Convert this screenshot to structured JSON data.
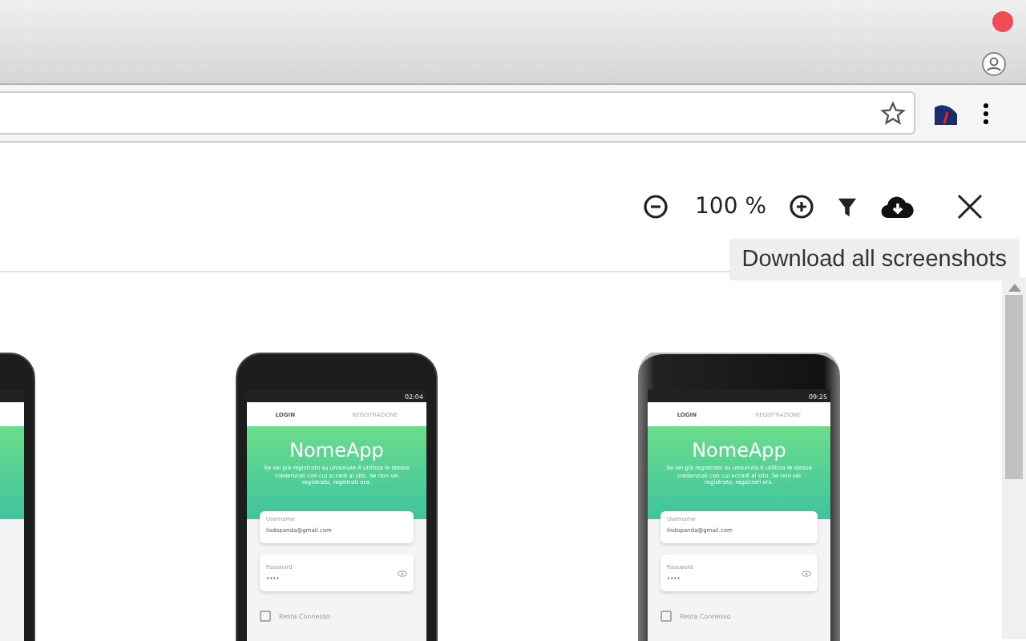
{
  "toolbar": {
    "zoom": "100 %",
    "tooltip": "Download all screenshots"
  },
  "screenshots": [
    {
      "kind": "cropped"
    },
    {
      "kind": "dark",
      "status_time": "02:04",
      "tabs": [
        {
          "label": "LOGIN",
          "selected": true
        },
        {
          "label": "REGISTRAZIONE",
          "selected": false
        }
      ],
      "app_title": "NomeApp",
      "intro": "Se sei già registrato su unisalute.it utilizza le stesse credenziali con cui accedi al sito. Se non sei registrato, registrati ora.",
      "username_label": "Username",
      "username_value": "lisdopanda@gmail.com",
      "password_label": "Password",
      "password_value": "••••",
      "remember": {
        "label": "Resta Connesso",
        "checked": false
      }
    },
    {
      "kind": "silver",
      "status_time": "09:25",
      "tabs": [
        {
          "label": "LOGIN",
          "selected": true
        },
        {
          "label": "REGISTRAZIONE",
          "selected": false
        }
      ],
      "app_title": "NomeApp",
      "intro": "Se sei già registrato su unisalute.it utilizza le stesse credenziali con cui accedi al sito. Se non sei registrato, registrati ora.",
      "username_label": "Username",
      "username_value": "lisdopanda@gmail.com",
      "password_label": "Password",
      "password_value": "••••",
      "remember": {
        "label": "Resta Connesso",
        "checked": false
      }
    }
  ]
}
